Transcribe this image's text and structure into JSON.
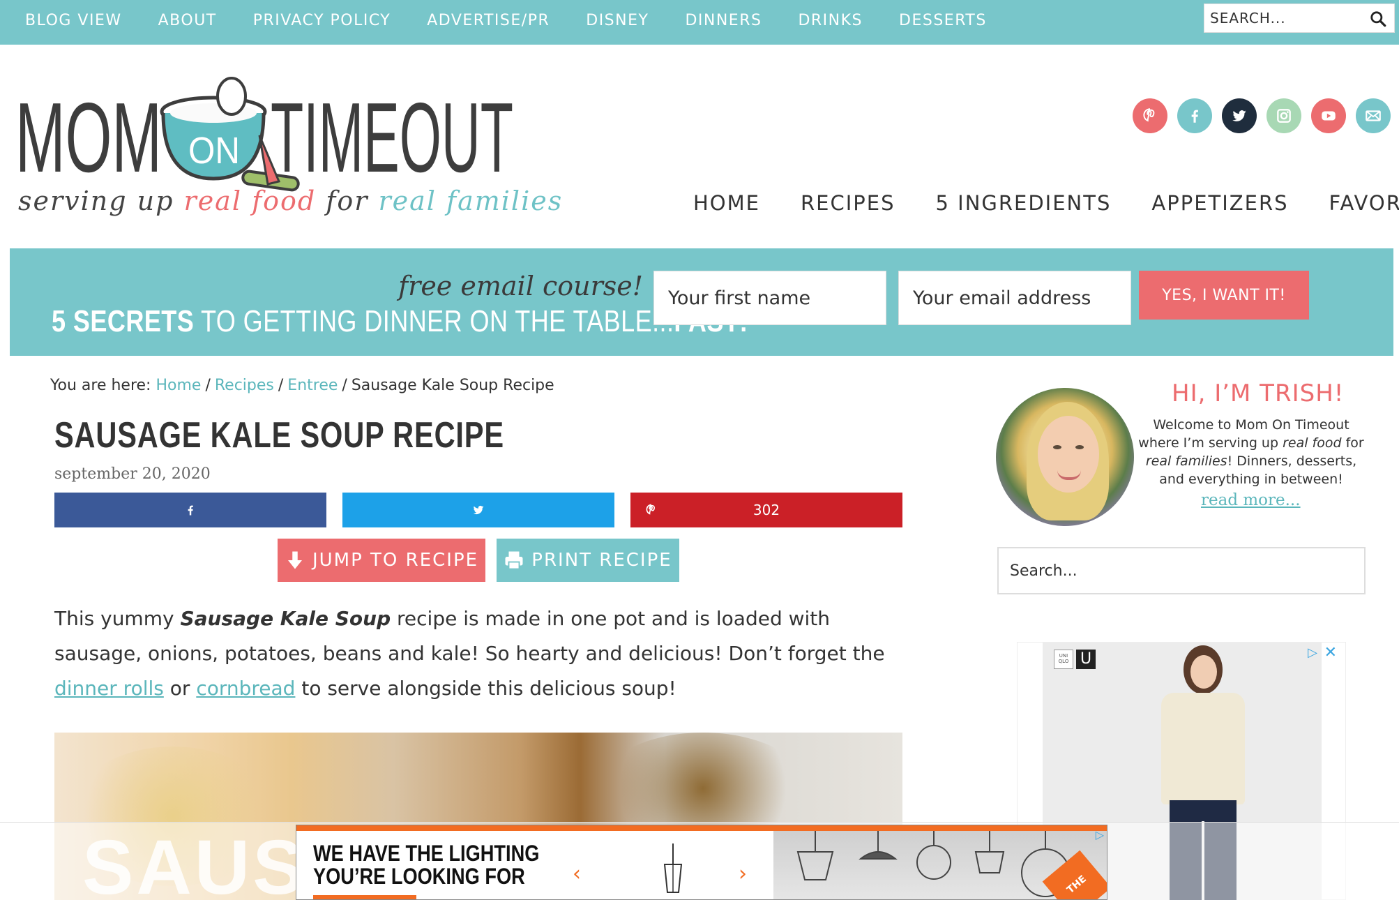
{
  "top_nav": {
    "items": [
      "BLOG VIEW",
      "ABOUT",
      "PRIVACY POLICY",
      "ADVERTISE/PR",
      "DISNEY",
      "DINNERS",
      "DRINKS",
      "DESSERTS"
    ],
    "search_placeholder": "SEARCH..."
  },
  "logo": {
    "mom": "MOM",
    "on": "ON",
    "timeout": "TIMEOUT"
  },
  "tagline": {
    "part1": "serving up ",
    "part2": "real food",
    "part3": " for ",
    "part4": "real families"
  },
  "social": [
    "pinterest-icon",
    "facebook-icon",
    "twitter-icon",
    "instagram-icon",
    "youtube-icon",
    "email-icon"
  ],
  "main_nav": [
    "HOME",
    "RECIPES",
    "5 INGREDIENTS",
    "APPETIZERS",
    "FAVORITES"
  ],
  "banner": {
    "script": "free email course!",
    "line_bold1": "5 SECRETS",
    "line_mid": " TO GETTING DINNER ON THE TABLE...",
    "line_bold2": "FAST!",
    "first_name_placeholder": "Your first name",
    "email_placeholder": "Your email address",
    "submit_label": "YES, I WANT IT!"
  },
  "breadcrumb": {
    "prefix": "You are here: ",
    "links": [
      "Home",
      "Recipes",
      "Entree"
    ],
    "current": "Sausage Kale Soup Recipe"
  },
  "post": {
    "title": "SAUSAGE KALE SOUP RECIPE",
    "date": "september 20, 2020",
    "pin_count": "302",
    "jump_label": "JUMP TO RECIPE",
    "print_label": "PRINT RECIPE",
    "intro_1": "This yummy ",
    "intro_bold": "Sausage Kale Soup",
    "intro_2": " recipe is made in one pot and is loaded with sausage, onions, potatoes, beans and kale! So hearty and delicious! Don’t forget the ",
    "link_rolls": "dinner rolls",
    "intro_3": " or ",
    "link_cornbread": "cornbread",
    "intro_4": " to serve alongside this delicious soup!",
    "hero_overlay": "SAUSA"
  },
  "sidebar": {
    "hi": "HI, I’M TRISH!",
    "welcome_1": "Welcome to Mom On Timeout where I’m serving up ",
    "welcome_em1": "real food",
    "welcome_2": " for ",
    "welcome_em2": "real families",
    "welcome_3": "! Dinners, desserts, and everything in between!",
    "read_more": "read more...",
    "search_placeholder": "Search..."
  },
  "side_ad": {
    "brand_small": "UNI QLO",
    "brand_u": "U"
  },
  "bottom_ad": {
    "headline_1": "WE HAVE THE LIGHTING",
    "headline_2": "YOU’RE LOOKING FOR",
    "prev": "‹",
    "next": "›",
    "badge": "THE HOME DEPOT"
  },
  "colors": {
    "teal": "#78c6ca",
    "coral": "#ec6c6f",
    "facebook": "#3b5998",
    "twitter": "#1da1e8",
    "pinterest": "#cb2027"
  }
}
